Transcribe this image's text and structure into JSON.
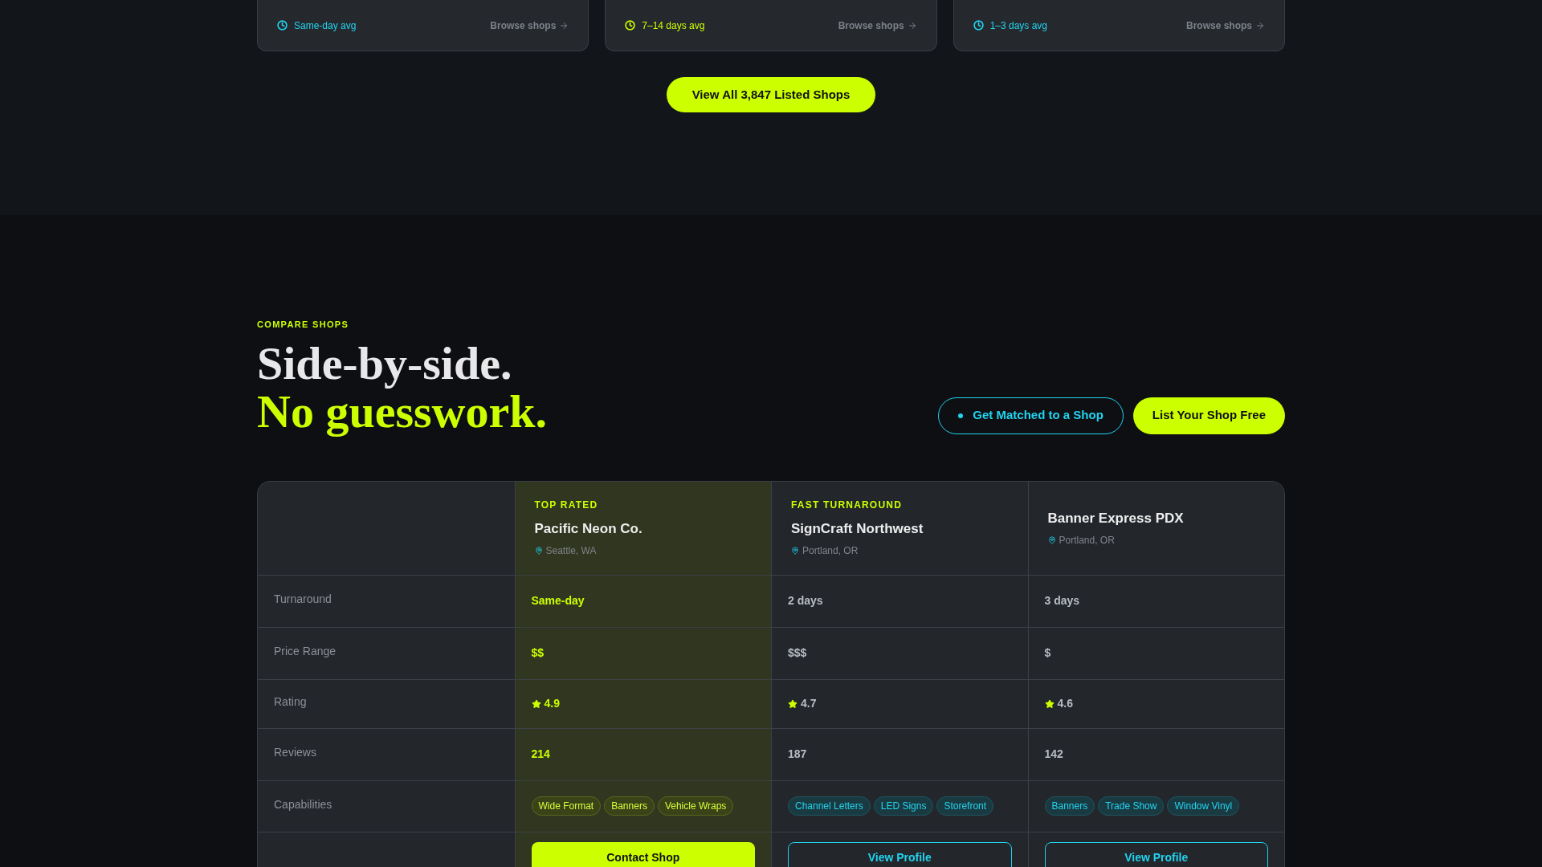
{
  "categories": [
    {
      "eta": "Same-day avg",
      "color": "#22d3ee",
      "link": "Browse shops"
    },
    {
      "eta": "7–14 days avg",
      "color": "#ccff00",
      "link": "Browse shops"
    },
    {
      "eta": "1–3 days avg",
      "color": "#22d3ee",
      "link": "Browse shops"
    }
  ],
  "view_all": "View All 3,847 Listed Shops",
  "compare": {
    "eyebrow": "COMPARE SHOPS",
    "title_line_1": "Side-by-side.",
    "title_line_2": "No guesswork.",
    "buttons": [
      {
        "label": "Get Matched to a Shop",
        "kind": "outline"
      },
      {
        "label": "List Your Shop Free",
        "kind": "solid"
      }
    ]
  },
  "table": {
    "row_labels": [
      "Turnaround",
      "Price Range",
      "Rating",
      "Reviews",
      "Capabilities"
    ],
    "shops": [
      {
        "badge": "TOP RATED",
        "name": "Pacific Neon Co.",
        "location": "Seattle, WA",
        "highlighted": true,
        "turnaround": "Same-day",
        "price": "$$",
        "rating": "4.9",
        "reviews": "214",
        "capabilities": [
          "Wide Format",
          "Banners",
          "Vehicle Wraps"
        ],
        "action": "Contact Shop"
      },
      {
        "badge": "FAST TURNAROUND",
        "name": "SignCraft Northwest",
        "location": "Portland, OR",
        "highlighted": false,
        "turnaround": "2 days",
        "price": "$$$",
        "rating": "4.7",
        "reviews": "187",
        "capabilities": [
          "Channel Letters",
          "LED Signs",
          "Storefront"
        ],
        "action": "View Profile"
      },
      {
        "name": "Banner Express PDX",
        "location": "Portland, OR",
        "highlighted": false,
        "turnaround": "3 days",
        "price": "$",
        "rating": "4.6",
        "reviews": "142",
        "capabilities": [
          "Banners",
          "Trade Show",
          "Window Vinyl"
        ],
        "action": "View Profile"
      }
    ]
  }
}
